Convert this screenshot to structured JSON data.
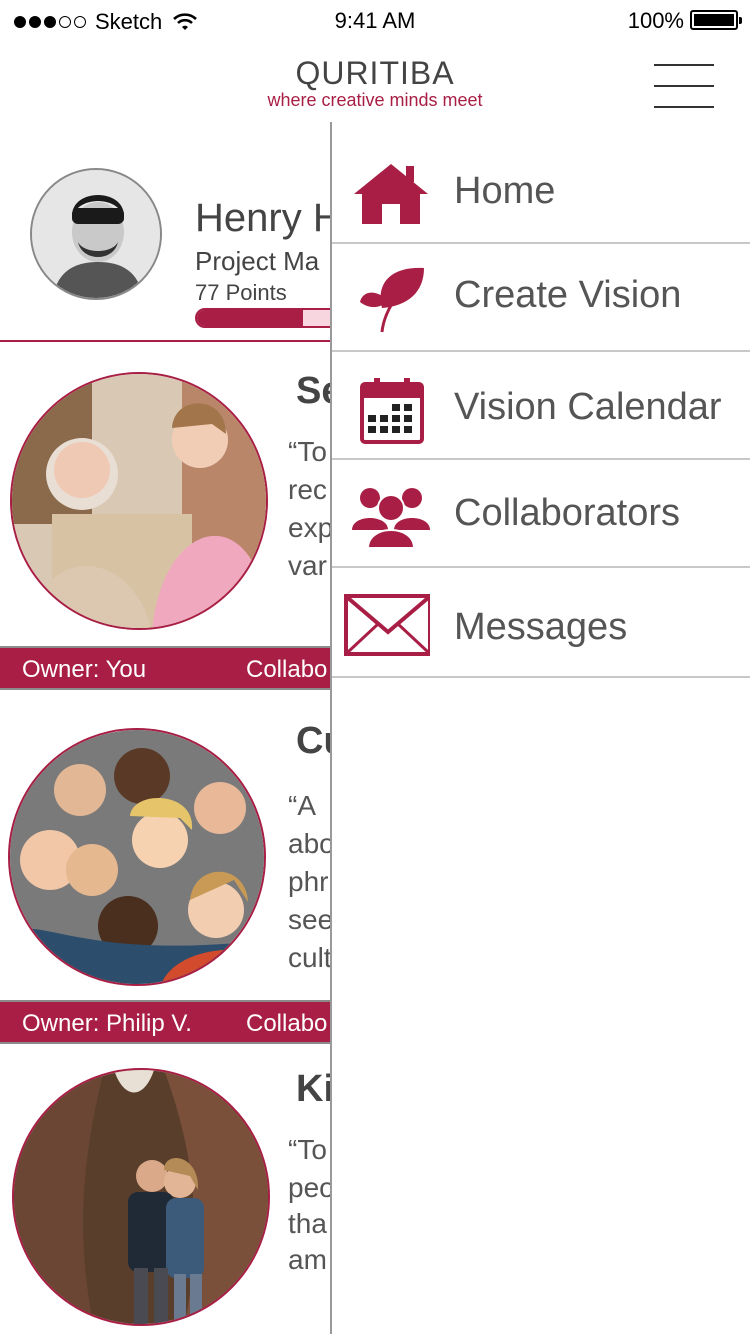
{
  "status_bar": {
    "carrier": "Sketch",
    "time": "9:41 AM",
    "battery": "100%"
  },
  "header": {
    "brand": "QURITIBA",
    "tagline": "where creative minds meet",
    "menu_icon": "hamburger-icon"
  },
  "profile": {
    "name": "Henry H",
    "role": "Project Ma",
    "points": "77 Points",
    "progress_fraction": 0.6
  },
  "cards": [
    {
      "title": "Se",
      "lines": [
        "“To",
        "rec",
        "exp",
        "var"
      ],
      "owner": "Owner: You",
      "collab": "Collabo"
    },
    {
      "title": "Cu",
      "lines": [
        "“A",
        "abo",
        "phr",
        "see",
        "cult"
      ],
      "owner": "Owner: Philip V.",
      "collab": "Collabo"
    },
    {
      "title": "Ki",
      "lines": [
        "“To",
        "peo",
        "tha",
        "am"
      ]
    }
  ],
  "menu": {
    "items": [
      {
        "label": "Home",
        "icon": "house-icon"
      },
      {
        "label": "Create Vision",
        "icon": "leaf-icon"
      },
      {
        "label": "Vision Calendar",
        "icon": "calendar-icon"
      },
      {
        "label": "Collaborators",
        "icon": "people-icon"
      },
      {
        "label": "Messages",
        "icon": "envelope-icon"
      }
    ]
  },
  "colors": {
    "accent": "#a81e44",
    "text": "#444444",
    "divider": "#c8c8c8"
  }
}
